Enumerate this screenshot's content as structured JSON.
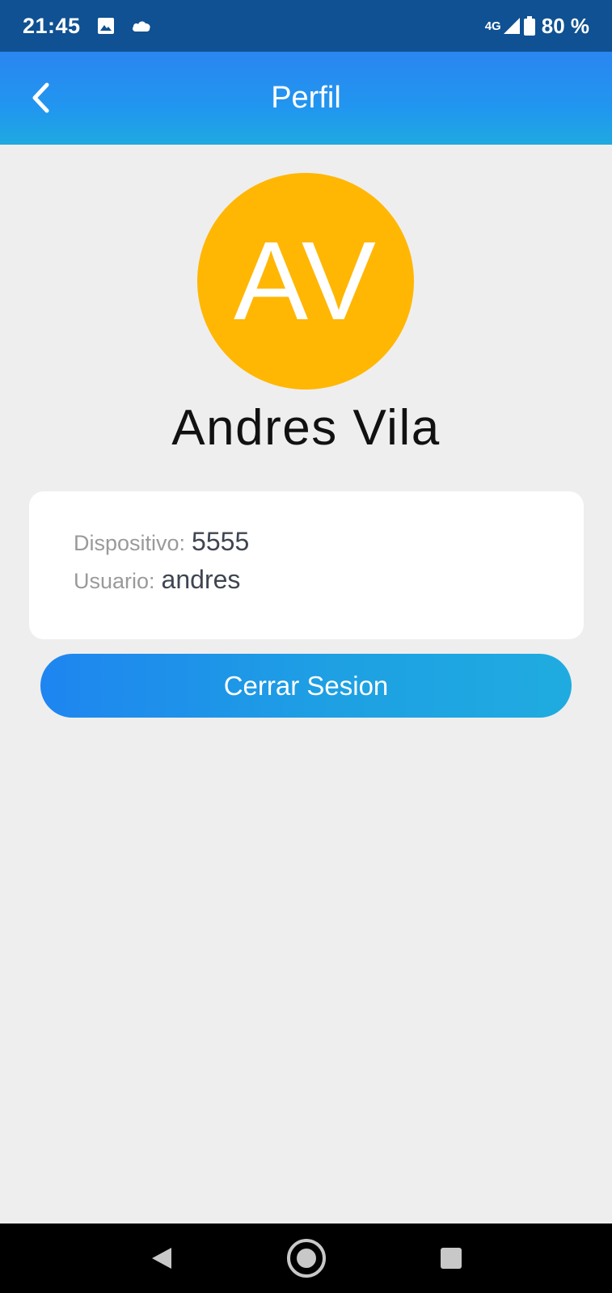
{
  "status_bar": {
    "time": "21:45",
    "icons": [
      "image-icon",
      "cloud-icon"
    ],
    "network": "4G",
    "battery": "80 %"
  },
  "app_bar": {
    "title": "Perfil",
    "back_icon": "chevron-left-icon"
  },
  "profile": {
    "initials": "AV",
    "avatar_color": "#ffb703",
    "name": "Andres Vila"
  },
  "info": {
    "device_label": "Dispositivo:",
    "device_value": "5555",
    "user_label": "Usuario:",
    "user_value": "andres"
  },
  "actions": {
    "logout_label": "Cerrar Sesion"
  },
  "nav_bar": {
    "icons": [
      "back-triangle-icon",
      "home-circle-icon",
      "recents-square-icon"
    ]
  },
  "colors": {
    "status_bar": "#0f5192",
    "app_bar_start": "#2a86f0",
    "app_bar_end": "#1fa9e0",
    "background": "#eeeeee",
    "card": "#ffffff"
  }
}
